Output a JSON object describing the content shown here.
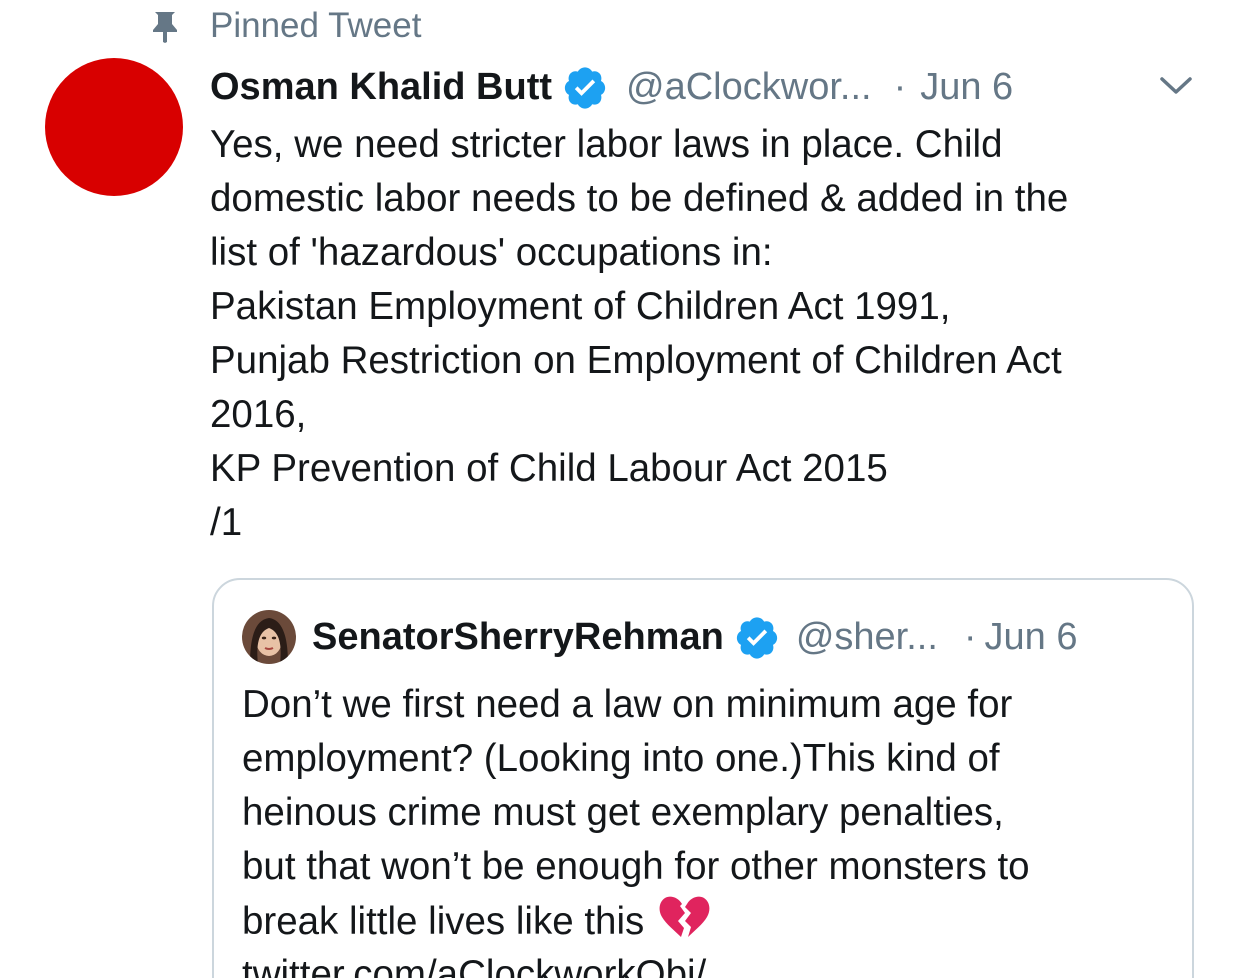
{
  "pinned": {
    "label": "Pinned Tweet",
    "icon": "pin-icon"
  },
  "tweet": {
    "avatar_color": "#d80000",
    "display_name": "Osman Khalid Butt",
    "handle": "@aClockwor...",
    "separator": "·",
    "date": "Jun 6",
    "menu_icon": "chevron-down-icon",
    "lines": [
      "Yes, we need stricter labor laws in place. Child",
      "domestic labor needs to be defined & added in the",
      "list of 'hazardous' occupations in:",
      "Pakistan Employment of Children Act 1991,",
      "Punjab Restriction on Employment of Children Act",
      "2016,",
      "KP Prevention of Child Labour Act 2015",
      "/1"
    ]
  },
  "quote": {
    "display_name": "SenatorSherryRehman",
    "handle": "@sher...",
    "separator": "·",
    "date": "Jun 6",
    "lines": [
      "Don’t we first need a law on minimum age for",
      "employment? (Looking into one.)This kind of",
      "heinous crime must get exemplary penalties,",
      "but that won’t be enough for other monsters to",
      "break little lives like this"
    ],
    "emoji": "broken-heart-icon",
    "link": "twitter.com/aClockworkObi/..."
  },
  "colors": {
    "text": "#14171a",
    "secondary": "#657786",
    "verified": "#1da1f2",
    "border": "#ccd6dd",
    "broken_heart": "#e0245e"
  }
}
